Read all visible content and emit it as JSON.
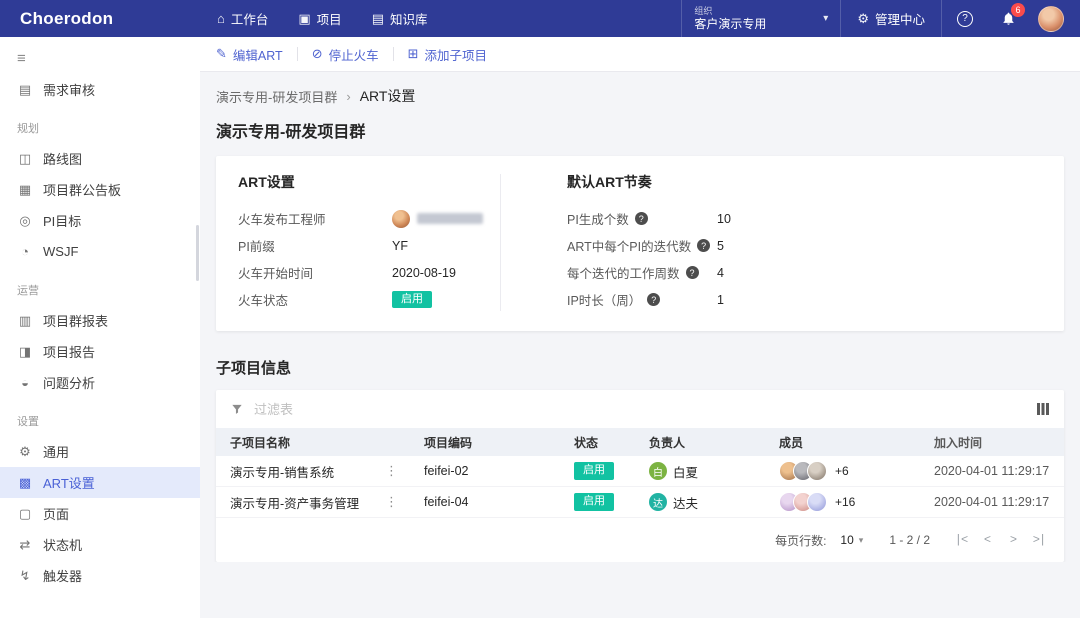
{
  "colors": {
    "header_bg": "#2F3B96",
    "accent_blue": "#4F63D0",
    "active_item_bg": "#E4EAFB",
    "status_green": "#12C2A2",
    "notification_red": "#FA4B4B"
  },
  "header": {
    "logo": "Choerodon",
    "nav": [
      {
        "label": "工作台",
        "icon": "workbench-icon",
        "glyph": "⌂"
      },
      {
        "label": "项目",
        "icon": "project-icon",
        "glyph": "▣"
      },
      {
        "label": "知识库",
        "icon": "knowledge-icon",
        "glyph": "▤"
      }
    ],
    "org": {
      "label": "组织",
      "value": "客户演示专用",
      "chevron": "▾"
    },
    "admin": {
      "label": "管理中心",
      "glyph": "⚙"
    },
    "help_glyph": "?",
    "notification_count": "6"
  },
  "sidebar": {
    "toggle_glyph": "≡",
    "sections": [
      {
        "title": "",
        "items": [
          {
            "label": "需求审核",
            "icon": "audit-icon",
            "glyph": "▤"
          }
        ]
      },
      {
        "title": "规划",
        "items": [
          {
            "label": "路线图",
            "icon": "roadmap-icon",
            "glyph": "◫"
          },
          {
            "label": "项目群公告板",
            "icon": "program-board-icon",
            "glyph": "▦"
          },
          {
            "label": "PI目标",
            "icon": "pi-target-icon",
            "glyph": "◎"
          },
          {
            "label": "WSJF",
            "icon": "wsjf-icon",
            "glyph": "◔"
          }
        ]
      },
      {
        "title": "运营",
        "items": [
          {
            "label": "项目群报表",
            "icon": "program-report-icon",
            "glyph": "▥"
          },
          {
            "label": "项目报告",
            "icon": "project-report-icon",
            "glyph": "◨"
          },
          {
            "label": "问题分析",
            "icon": "issue-analysis-icon",
            "glyph": "◒"
          }
        ]
      },
      {
        "title": "设置",
        "items": [
          {
            "label": "通用",
            "icon": "general-settings-icon",
            "glyph": "⚙"
          },
          {
            "label": "ART设置",
            "icon": "art-settings-icon",
            "glyph": "▩",
            "active": true
          },
          {
            "label": "页面",
            "icon": "page-icon",
            "glyph": "▢"
          },
          {
            "label": "状态机",
            "icon": "state-machine-icon",
            "glyph": "⇄"
          },
          {
            "label": "触发器",
            "icon": "trigger-icon",
            "glyph": "↯"
          }
        ]
      }
    ]
  },
  "toolbar": {
    "actions": [
      {
        "label": "编辑ART",
        "icon": "edit-icon",
        "glyph": "✎"
      },
      {
        "label": "停止火车",
        "icon": "stop-icon",
        "glyph": "⊘"
      },
      {
        "label": "添加子项目",
        "icon": "add-icon",
        "glyph": "⊞"
      }
    ]
  },
  "breadcrumb": {
    "parent": "演示专用-研发项目群",
    "separator": "›",
    "current": "ART设置"
  },
  "page_title": "演示专用-研发项目群",
  "art": {
    "title": "ART设置",
    "fields": [
      {
        "label": "火车发布工程师",
        "value": ""
      },
      {
        "label": "PI前缀",
        "value": "YF"
      },
      {
        "label": "火车开始时间",
        "value": "2020-08-19"
      },
      {
        "label": "火车状态",
        "value": "启用"
      }
    ],
    "cadence": {
      "title": "默认ART节奏",
      "help_glyph": "?",
      "rows": [
        {
          "label": "PI生成个数",
          "value": "10"
        },
        {
          "label": "ART中每个PI的迭代数",
          "value": "5"
        },
        {
          "label": "每个迭代的工作周数",
          "value": "4"
        },
        {
          "label": "IP时长（周）",
          "value": "1"
        }
      ]
    }
  },
  "subprojects": {
    "title": "子项目信息",
    "filter_placeholder": "过滤表",
    "columns": [
      "子项目名称",
      "项目编码",
      "状态",
      "负责人",
      "成员",
      "加入时间"
    ],
    "rows": [
      {
        "name": "演示专用-销售系统",
        "menu_glyph": "⋮",
        "code": "feifei-02",
        "status": "启用",
        "owner_initial": "白",
        "owner_name": "白夏",
        "members_extra": "+6",
        "joined": "2020-04-01 11:29:17"
      },
      {
        "name": "演示专用-资产事务管理",
        "menu_glyph": "⋮",
        "code": "feifei-04",
        "status": "启用",
        "owner_initial": "达",
        "owner_name": "达夫",
        "members_extra": "+16",
        "joined": "2020-04-01 11:29:17"
      }
    ],
    "pagination": {
      "rows_label": "每页行数:",
      "per_page": "10",
      "caret": "▾",
      "range": "1 - 2 / 2",
      "first": "|<",
      "prev": "<",
      "next": ">",
      "last": ">|"
    }
  }
}
